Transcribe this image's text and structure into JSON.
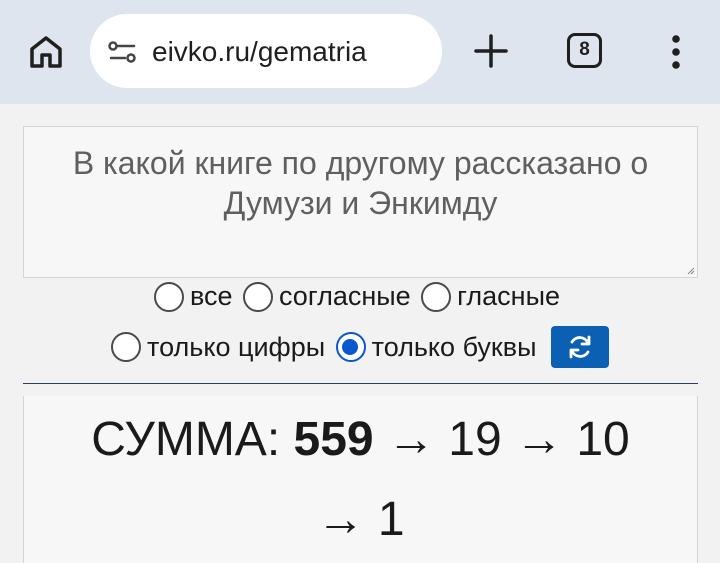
{
  "browser": {
    "url": "eivko.ru/gematria",
    "tab_count": "8"
  },
  "question": {
    "text": "В какой книге по другому рассказано о Думузи и Энкимду"
  },
  "options": [
    {
      "label": "все",
      "checked": false
    },
    {
      "label": "согласные",
      "checked": false
    },
    {
      "label": "гласные",
      "checked": false
    },
    {
      "label": "только цифры",
      "checked": false
    },
    {
      "label": "только буквы",
      "checked": true
    }
  ],
  "result": {
    "label": "СУММА:",
    "sum": "559",
    "step1": "→ 19 → 10",
    "step2": "→ 1"
  },
  "colors": {
    "accent": "#0b57d0",
    "refresh_button": "#0c60b4",
    "toolbar": "#dfe5ee"
  }
}
